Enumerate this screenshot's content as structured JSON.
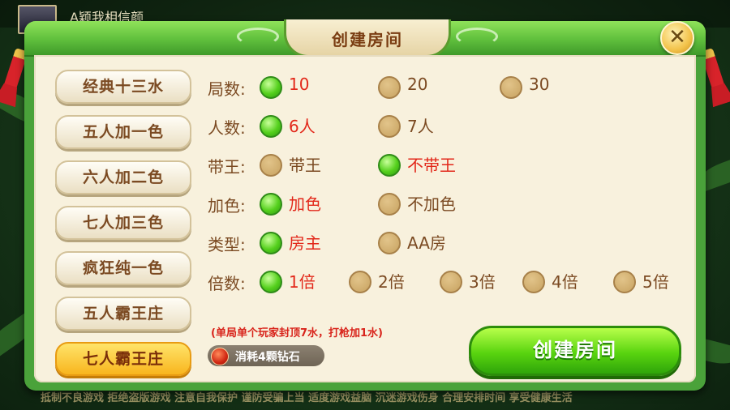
{
  "header": {
    "player_name": "A颖我相信颜",
    "bottom_ticker": "抵制不良游戏  拒绝盗版游戏  注意自我保护  谨防受骗上当  适度游戏益脑  沉迷游戏伤身  合理安排时间  享受健康生活"
  },
  "dialog": {
    "title": "创建房间",
    "close_label": "✕"
  },
  "modes": [
    {
      "label": "经典十三水",
      "active": false
    },
    {
      "label": "五人加一色",
      "active": false
    },
    {
      "label": "六人加二色",
      "active": false
    },
    {
      "label": "七人加三色",
      "active": false
    },
    {
      "label": "疯狂纯一色",
      "active": false
    },
    {
      "label": "五人霸王庄",
      "active": false
    },
    {
      "label": "七人霸王庄",
      "active": true
    }
  ],
  "options": {
    "rounds": {
      "label": "局数:",
      "choices": [
        "10",
        "20",
        "30"
      ],
      "selected": 0
    },
    "players": {
      "label": "人数:",
      "choices": [
        "6人",
        "7人"
      ],
      "selected": 0
    },
    "king": {
      "label": "带王:",
      "choices": [
        "带王",
        "不带王"
      ],
      "selected": 1
    },
    "color": {
      "label": "加色:",
      "choices": [
        "加色",
        "不加色"
      ],
      "selected": 0
    },
    "type": {
      "label": "类型:",
      "choices": [
        "房主",
        "AA房"
      ],
      "selected": 0
    },
    "multiplier": {
      "label": "倍数:",
      "choices": [
        "1倍",
        "2倍",
        "3倍",
        "4倍",
        "5倍"
      ],
      "selected": 0
    }
  },
  "note": "(单局单个玩家封顶7水，打枪加1水)",
  "cost": "消耗4颗钻石",
  "create_button": "创建房间",
  "colors": {
    "selected_radio": "#55d01d",
    "selected_text": "#e2281a",
    "normal_text": "#7b4a22",
    "active_mode": "#f8b51e"
  }
}
